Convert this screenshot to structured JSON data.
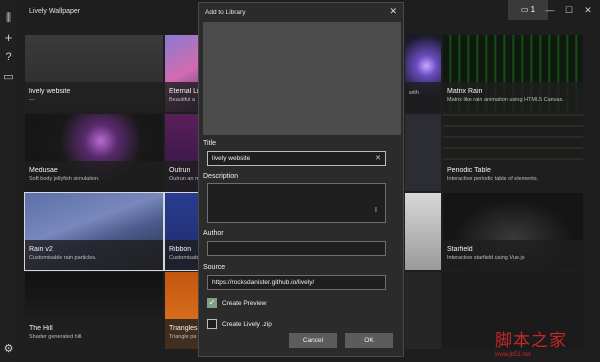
{
  "app": {
    "title": "Lively Wallpaper",
    "monitor_count": "1"
  },
  "window_controls": {
    "minimize": "—",
    "maximize": "☐",
    "close": "✕"
  },
  "rail": {
    "library": "⫼",
    "add": "+",
    "help": "?",
    "feedback": "▭",
    "settings": "⚙"
  },
  "tiles": [
    {
      "title": "lively website",
      "desc": "—"
    },
    {
      "title": "Eternal Li",
      "desc": "Beautiful a"
    },
    {
      "title": "Medusae",
      "desc": "Soft body jellyfish simulation."
    },
    {
      "title": "Outrun",
      "desc": "Outrun an mountains"
    },
    {
      "title": "Rain v2",
      "desc": "Customisable rain particles."
    },
    {
      "title": "Ribbon",
      "desc": "Customisable"
    },
    {
      "title": "The Hill",
      "desc": "Shader generated hill."
    },
    {
      "title": "Triangles",
      "desc": "Triangle pa background"
    },
    {
      "title": "Matrix Rain",
      "desc": "Matrix like rain animation using HTML5 Canvas."
    },
    {
      "title": "Periodic Table",
      "desc": "Interactive periodic table of elements."
    },
    {
      "title": "Starfield",
      "desc": "Interactive starfield using Vue.js"
    },
    {
      "title": "",
      "desc": "with"
    }
  ],
  "dialog": {
    "title": "Add to Library",
    "close": "✕",
    "title_label": "Title",
    "title_value": "lively website",
    "clear_icon": "✕",
    "description_label": "Description",
    "description_value": "",
    "caret": "I",
    "author_label": "Author",
    "author_value": "",
    "source_label": "Source",
    "source_value": "https://rocksdanister.github.io/lively/",
    "create_preview_label": "Create Preview",
    "create_preview_checked": true,
    "create_zip_label": "Create Lively .zip",
    "create_zip_checked": false,
    "cancel_label": "Cancel",
    "ok_label": "OK"
  },
  "watermark": {
    "text": "脚本之家",
    "url": "www.jb51.net"
  }
}
